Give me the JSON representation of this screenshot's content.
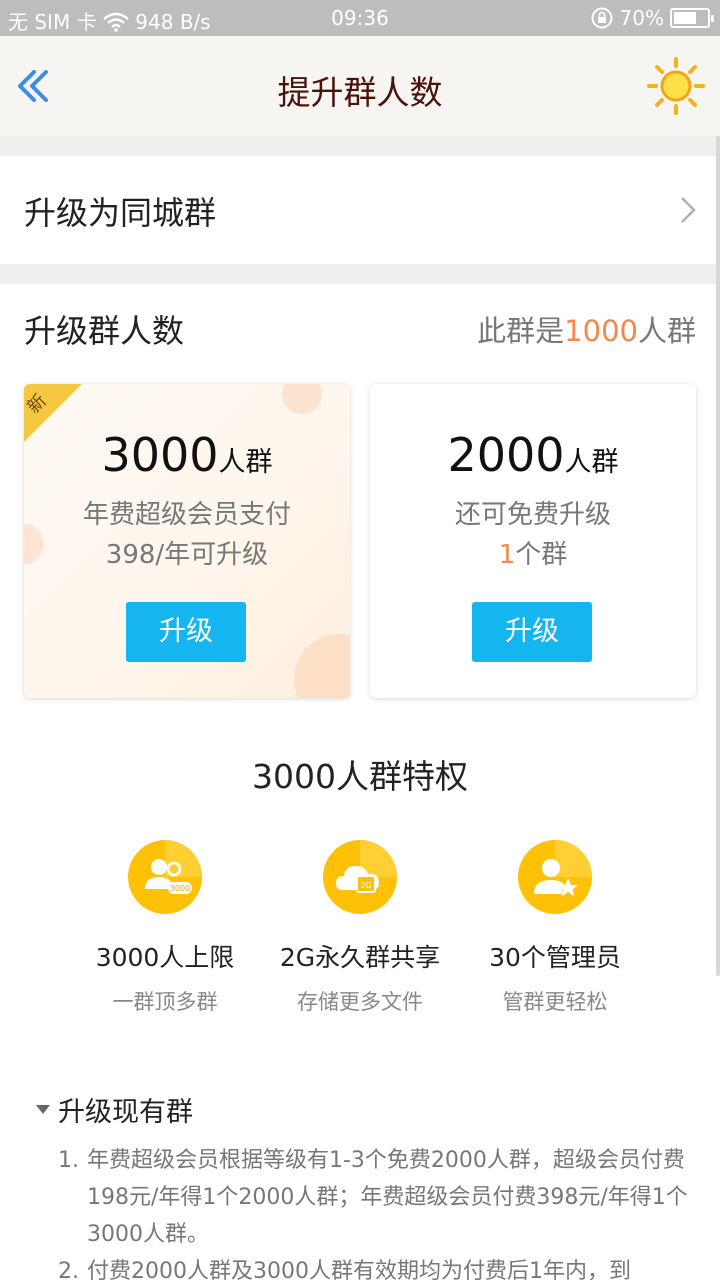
{
  "status_bar": {
    "left": "无 SIM 卡 ",
    "speed": "948 B/s",
    "time": "09:36",
    "battery": "70%",
    "battery_level": 0.7
  },
  "nav": {
    "title": "提升群人数",
    "back_icon": "double-chevron-left-icon",
    "right_icon": "sun-icon"
  },
  "city_row": {
    "label": "升级为同城群"
  },
  "upgrade_section": {
    "title": "升级群人数",
    "current_prefix": "此群是",
    "current_count": "1000",
    "current_suffix": "人群"
  },
  "cards": [
    {
      "badge": "新",
      "number": "3000",
      "unit": "人群",
      "line1": "年费超级会员支付",
      "line2": "398/年可升级",
      "button": "升级"
    },
    {
      "number": "2000",
      "unit": "人群",
      "line1": "还可免费升级",
      "line2_count": "1",
      "line2_suffix": "个群",
      "button": "升级"
    }
  ],
  "privileges": {
    "title": "3000人群特权",
    "items": [
      {
        "icon": "group-3000-icon",
        "icon_text": "3000",
        "title": "3000人上限",
        "subtitle": "一群顶多群"
      },
      {
        "icon": "cloud-2g-icon",
        "icon_text": "2G",
        "title": "2G永久群共享",
        "subtitle": "存储更多文件"
      },
      {
        "icon": "admin-star-icon",
        "title": "30个管理员",
        "subtitle": "管群更轻松"
      }
    ]
  },
  "faq": {
    "title": "升级现有群",
    "items": [
      {
        "num": "1.",
        "text": "年费超级会员根据等级有1-3个免费2000人群，超级会员付费198元/年得1个2000人群；年费超级会员付费398元/年得1个3000人群。"
      },
      {
        "num": "2.",
        "text": "付费2000人群及3000人群有效期均为付费后1年内，到"
      }
    ]
  },
  "colors": {
    "accent_blue": "#15b5f0",
    "highlight_orange": "#f4874b",
    "icon_yellow": "#ffc107",
    "title_brown": "#4a1208"
  }
}
